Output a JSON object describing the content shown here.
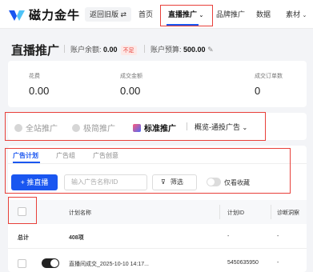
{
  "topbar": {
    "brand": "磁力金牛",
    "old_version": "返回旧版",
    "old_version_icon": "swap-icon",
    "nav": [
      "首页",
      "直播推广",
      "品牌推广",
      "数据",
      "素材"
    ],
    "active_nav_index": 1
  },
  "header": {
    "title": "直播推广",
    "balance_label": "账户余额:",
    "balance_value": "0.00",
    "balance_tag": "不足",
    "budget_label": "账户预算:",
    "budget_value": "500.00"
  },
  "metrics": [
    {
      "label": "花费",
      "value": "0.00"
    },
    {
      "label": "成交金额",
      "value": "0.00"
    },
    {
      "label": "成交订单数",
      "value": "0"
    }
  ],
  "modes": [
    "全站推广",
    "极简推广",
    "标准推广"
  ],
  "active_mode_index": 2,
  "overview": "概览-通投广告",
  "subtabs": [
    "广告计划",
    "广告组",
    "广告创意"
  ],
  "active_subtab_index": 0,
  "toolbar": {
    "add_label": "推直播",
    "search_placeholder": "输入广告名称/ID",
    "filter_label": "筛选",
    "favorites_label": "仅看收藏"
  },
  "table": {
    "columns": [
      "计划名称",
      "计划ID",
      "诊断洞察"
    ],
    "total_row": {
      "label": "总计",
      "name": "408项",
      "id": "-",
      "diag": "-"
    },
    "rows": [
      {
        "name": "直播间成交_2025-10-10 14:17...",
        "id": "5450635950",
        "diag": "-"
      }
    ]
  },
  "colors": {
    "accent": "#1a56f0",
    "highlight_box": "#e8403a"
  }
}
